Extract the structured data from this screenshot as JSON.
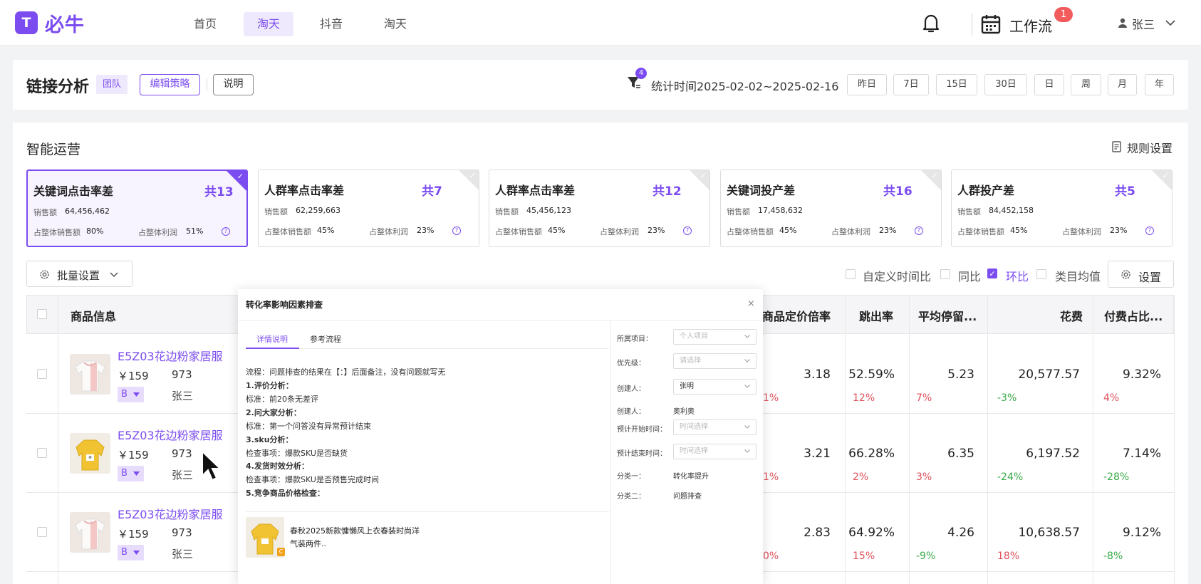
{
  "app": {
    "logo_glyph": "T",
    "name": "必牛",
    "brand_color": "#7b4cf0"
  },
  "nav": [
    {
      "label": "首页",
      "active": false
    },
    {
      "label": "淘天",
      "active": true
    },
    {
      "label": "抖音",
      "active": false
    },
    {
      "label": "淘天",
      "active": false
    }
  ],
  "header": {
    "workflow_label": "工作流",
    "workflow_badge": "1",
    "user_name": "张三",
    "bell_icon": "bell-icon",
    "calendar_icon": "calendar-icon"
  },
  "toolbar": {
    "title": "链接分析",
    "team_tag": "团队",
    "edit_btn": "编辑策略",
    "explain_btn": "说明",
    "filter_count": "4",
    "stat_range": "统计时间2025-02-02~2025-02-16",
    "date_btns": [
      "昨日",
      "7日",
      "15日",
      "30日",
      "日",
      "周",
      "月",
      "年"
    ]
  },
  "smart": {
    "title": "智能运营",
    "rule_label": "规则设置",
    "cards": [
      {
        "name": "关键词点击率差",
        "count": "共13",
        "sales_label": "销售额",
        "sales": "64,456,462",
        "share_label": "占整体销售额",
        "share": "80%",
        "profit_label": "占整体利润",
        "profit": "51%",
        "selected": true
      },
      {
        "name": "人群率点击率差",
        "count": "共7",
        "sales_label": "销售额",
        "sales": "62,259,663",
        "share_label": "占整体销售额",
        "share": "45%",
        "profit_label": "占整体利润",
        "profit": "23%",
        "selected": false
      },
      {
        "name": "人群率点击率差",
        "count": "共12",
        "sales_label": "销售额",
        "sales": "45,456,123",
        "share_label": "占整体销售额",
        "share": "45%",
        "profit_label": "占整体利润",
        "profit": "23%",
        "selected": false
      },
      {
        "name": "关键词投产差",
        "count": "共16",
        "sales_label": "销售额",
        "sales": "17,458,632",
        "share_label": "占整体销售额",
        "share": "45%",
        "profit_label": "占整体利润",
        "profit": "23%",
        "selected": false
      },
      {
        "name": "人群投产差",
        "count": "共5",
        "sales_label": "销售额",
        "sales": "84,452,158",
        "share_label": "占整体销售额",
        "share": "45%",
        "profit_label": "占整体利润",
        "profit": "23%",
        "selected": false
      }
    ]
  },
  "table_ctrl": {
    "bulk_label": "批量设置",
    "options": [
      {
        "label": "自定义时间比",
        "checked": false
      },
      {
        "label": "同比",
        "checked": false
      },
      {
        "label": "环比",
        "checked": true
      },
      {
        "label": "类目均值",
        "checked": false
      }
    ],
    "settings_label": "设置"
  },
  "table": {
    "headers": [
      "商品信息",
      "商品定价倍率",
      "跳出率",
      "平均停留...",
      "花费",
      "付费占比..."
    ],
    "rows": [
      {
        "name": "E5Z03花边粉家居服",
        "price": "￥159",
        "qty": "973",
        "tag": "B",
        "owner": "张三",
        "hidden_chg": "1%",
        "color": "pink",
        "vals": [
          "3.18",
          "52.59%",
          "5.23",
          "20,577.57",
          "9.32%"
        ],
        "chgs": [
          {
            "t": "12%",
            "c": "red"
          },
          {
            "t": "7%",
            "c": "red"
          },
          {
            "t": "-3%",
            "c": "green"
          },
          {
            "t": "4%",
            "c": "red"
          }
        ]
      },
      {
        "name": "E5Z03花边粉家居服",
        "price": "￥159",
        "qty": "973",
        "tag": "B",
        "owner": "张三",
        "hidden_chg": "1%",
        "color": "yellow",
        "vals": [
          "3.21",
          "66.28%",
          "6.35",
          "6,197.52",
          "7.14%"
        ],
        "chgs": [
          {
            "t": "2%",
            "c": "red"
          },
          {
            "t": "3%",
            "c": "red"
          },
          {
            "t": "-24%",
            "c": "green"
          },
          {
            "t": "-28%",
            "c": "green"
          }
        ]
      },
      {
        "name": "E5Z03花边粉家居服",
        "price": "￥159",
        "qty": "973",
        "tag": "B",
        "owner": "张三",
        "hidden_chg": "0%",
        "color": "pink",
        "vals": [
          "2.83",
          "64.92%",
          "4.26",
          "10,638.57",
          "9.12%"
        ],
        "chgs": [
          {
            "t": "15%",
            "c": "red"
          },
          {
            "t": "-9%",
            "c": "green"
          },
          {
            "t": "18%",
            "c": "red"
          },
          {
            "t": "-8%",
            "c": "green"
          }
        ]
      }
    ]
  },
  "modal": {
    "title": "转化率影响因素排查",
    "close": "×",
    "tabs": [
      "详情说明",
      "参考流程"
    ],
    "lines": [
      {
        "t": "流程：问题排查的结果在【：】后面备注，没有问题就写无",
        "b": false
      },
      {
        "t": "1.评价分析：",
        "b": true
      },
      {
        "t": "标准：前20条无差评",
        "b": false
      },
      {
        "t": "2.问大家分析：",
        "b": true
      },
      {
        "t": "标准：第一个问答没有异常预计结束",
        "b": false
      },
      {
        "t": "3.sku分析：",
        "b": true
      },
      {
        "t": "检查事项：爆款SKU是否缺货",
        "b": false
      },
      {
        "t": "4.发货时效分析：",
        "b": true
      },
      {
        "t": "检查事项：爆款SKU是否预售完成时间",
        "b": false
      },
      {
        "t": "5.竞争商品价格检查：",
        "b": true
      }
    ],
    "product": {
      "title": "春秋2025新款慵懒风上衣春装时尚洋气装两件..",
      "tag": "C"
    },
    "fields": [
      {
        "label": "所属项目：",
        "value": "个人项目",
        "kind": "select",
        "filled": false
      },
      {
        "label": "优先级：",
        "value": "请选择",
        "kind": "select",
        "filled": false
      },
      {
        "label": "创建人：",
        "value": "张明",
        "kind": "select",
        "filled": true
      },
      {
        "label": "创建人：",
        "value": "奥利奥",
        "kind": "text"
      },
      {
        "label": "预计开始时间：",
        "value": "时间选择",
        "kind": "select",
        "filled": false
      },
      {
        "label": "预计结束时间：",
        "value": "时间选择",
        "kind": "select",
        "filled": false
      },
      {
        "label": "分类一：",
        "value": "转化率提升",
        "kind": "text"
      },
      {
        "label": "分类二：",
        "value": "问题排查",
        "kind": "text"
      }
    ]
  }
}
